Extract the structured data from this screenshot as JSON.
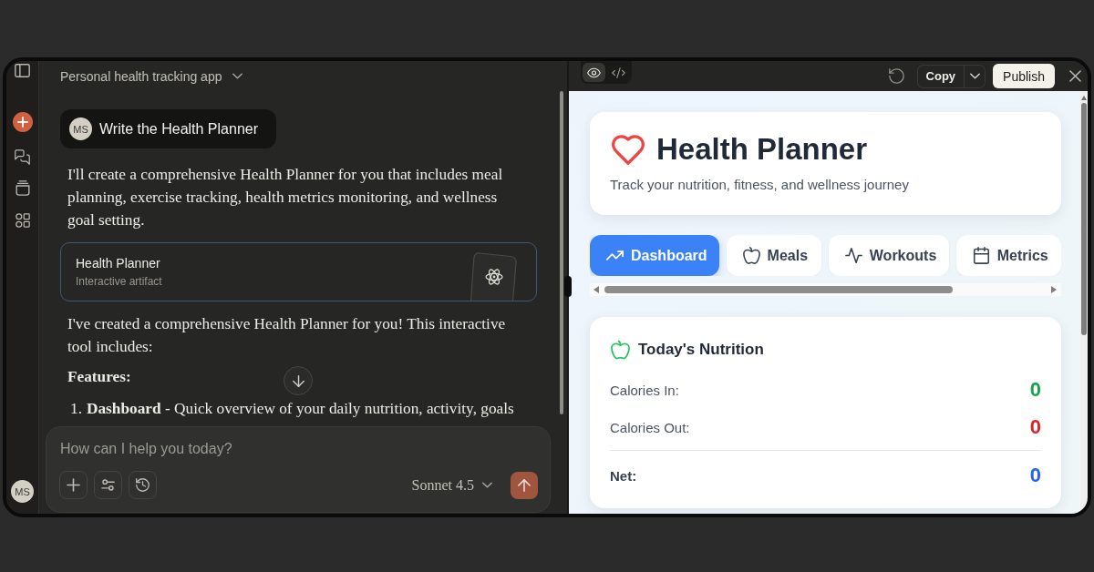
{
  "sidebar": {
    "avatar": "MS"
  },
  "chat": {
    "title": "Personal health tracking app",
    "messages": [
      {
        "kind": "user",
        "avatar": "MS",
        "text": "Write the Health Planner"
      },
      {
        "kind": "paragraph",
        "text": "I'll create a comprehensive Health Planner for you that includes meal planning, exercise tracking, health metrics monitoring, and wellness goal setting."
      },
      {
        "kind": "artifact",
        "title": "Health Planner",
        "subtitle": "Interactive artifact"
      },
      {
        "kind": "paragraph",
        "text": "I've created a comprehensive Health Planner for you! This interactive tool includes:"
      },
      {
        "kind": "heading",
        "text": "Features:"
      },
      {
        "kind": "list_item",
        "number": "1.",
        "text": "**Dashboard** - Quick overview of your daily nutrition, activity, goals"
      }
    ],
    "composer": {
      "placeholder": "How can I help you today?",
      "model": "Sonnet 4.5"
    }
  },
  "artifact": {
    "view_modes": [
      {
        "selected": true
      },
      {
        "selected": false
      }
    ],
    "copy_label": "Copy",
    "publish_label": "Publish",
    "header": {
      "title": "Health Planner",
      "subtitle": "Track your nutrition, fitness, and wellness journey"
    },
    "tabs": [
      {
        "label": "Dashboard",
        "selected": true
      },
      {
        "label": "Meals",
        "selected": false
      },
      {
        "label": "Workouts",
        "selected": false
      },
      {
        "label": "Metrics",
        "selected": false
      }
    ],
    "nutrition": {
      "title": "Today's Nutrition",
      "rows": [
        {
          "kind": "item",
          "label": "Calories In:",
          "value": "0",
          "color": "#16a34a"
        },
        {
          "kind": "item",
          "label": "Calories Out:",
          "value": "0",
          "color": "#dc2626"
        },
        {
          "kind": "total",
          "label": "Net:",
          "value": "0",
          "color": "#2563eb"
        }
      ]
    }
  }
}
